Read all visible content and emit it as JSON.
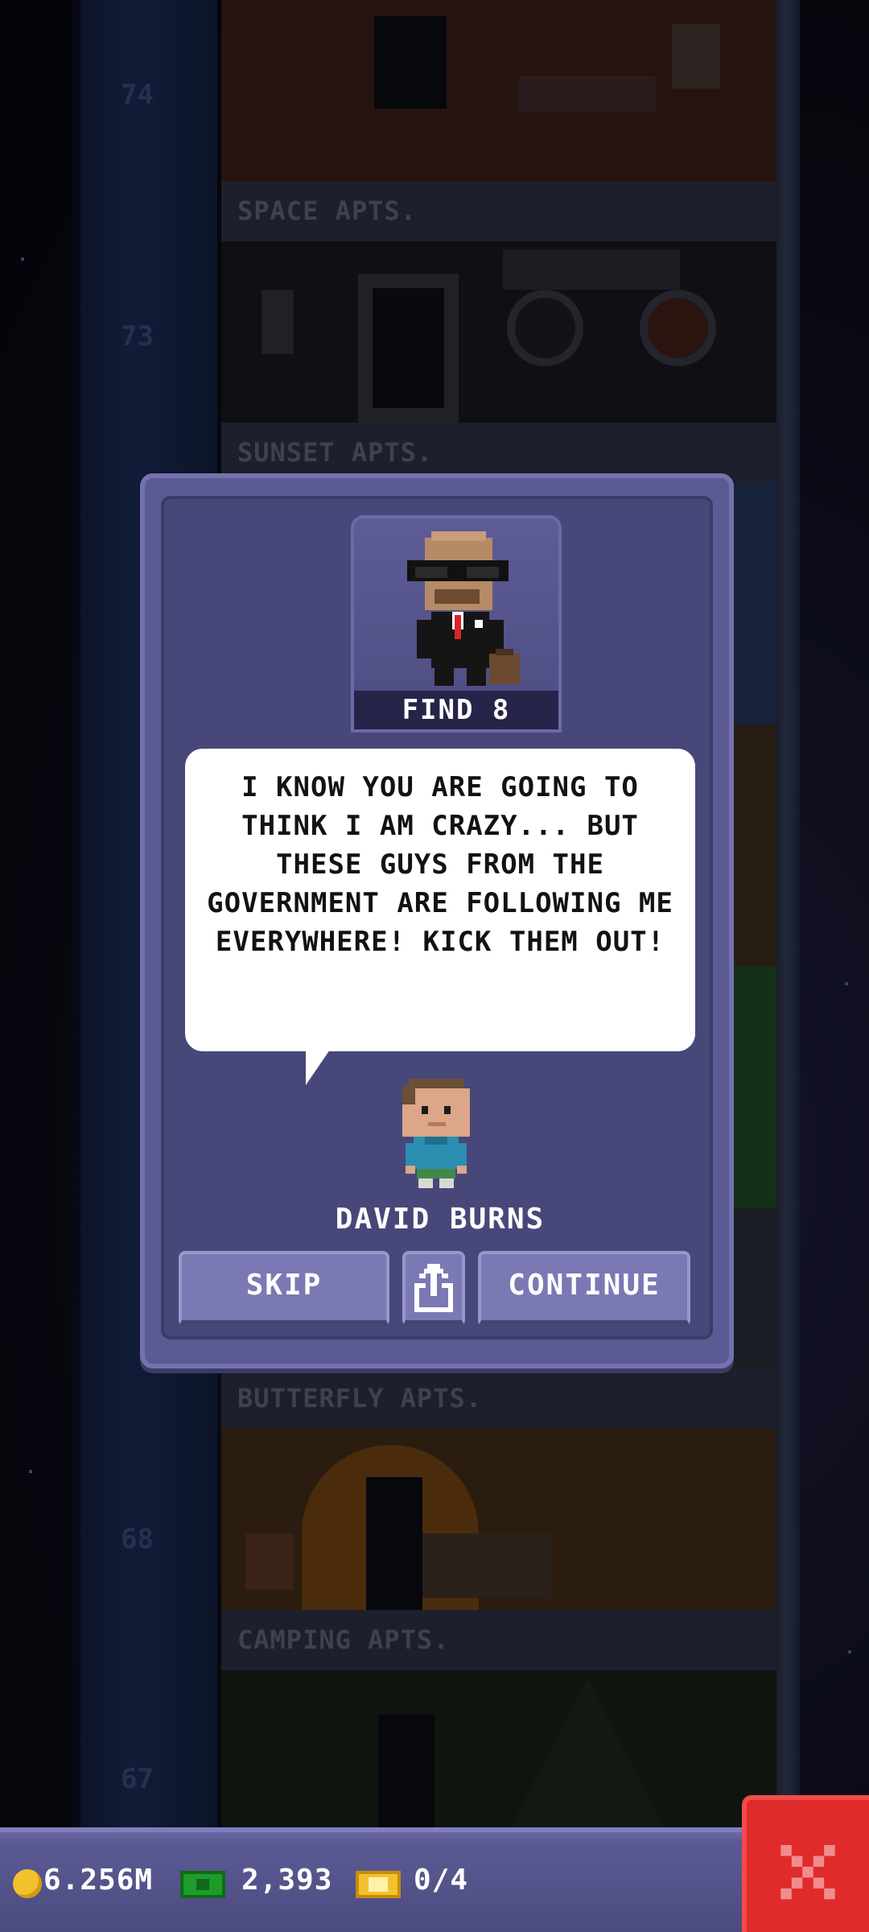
{
  "tower": {
    "floors": [
      {
        "number": "74",
        "name": "SPACE APTS."
      },
      {
        "number": "73",
        "name": "SUNSET APTS."
      },
      {
        "number": "68",
        "name": "BUTTERFLY APTS."
      },
      {
        "number": "67",
        "name": "CAMPING APTS."
      }
    ]
  },
  "dialog": {
    "portrait_caption": "FIND 8",
    "message": "I KNOW YOU ARE GOING TO THINK I AM CRAZY... BUT THESE GUYS FROM THE GOVERNMENT ARE FOLLOWING ME EVERYWHERE! KICK THEM OUT!",
    "npc_name": "DAVID BURNS",
    "buttons": {
      "skip": "SKIP",
      "share_icon": "share-icon",
      "continue": "CONTINUE"
    }
  },
  "bottom_bar": {
    "coins": "6.256M",
    "bux": "2,393",
    "tickets": "0/4",
    "close_icon": "close-icon"
  },
  "colors": {
    "dialog_bg": "#5b5a92",
    "button_bg": "#7b79b4",
    "close_bg": "#e02b2b",
    "coin": "#f3c12c",
    "bux": "#1d9c2c"
  }
}
